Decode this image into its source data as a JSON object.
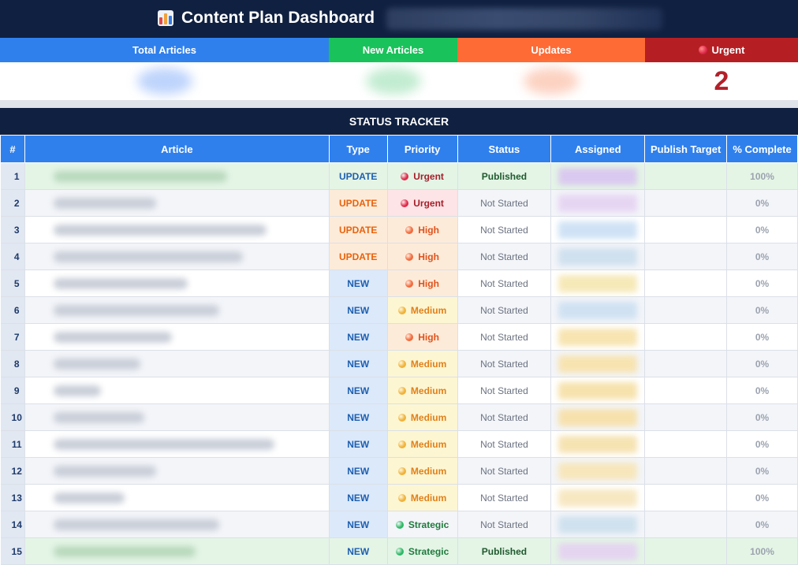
{
  "app": {
    "title": "Content Plan Dashboard",
    "icon": "bar-chart-icon"
  },
  "kpis": [
    {
      "label": "Total Articles",
      "color": "#2f80ed",
      "value": ""
    },
    {
      "label": "New Articles",
      "color": "#19c25a",
      "value": ""
    },
    {
      "label": "Updates",
      "color": "#ff6b35",
      "value": ""
    },
    {
      "label": "Urgent",
      "color": "#b51f24",
      "value": "2",
      "icon": "red-circle-icon"
    }
  ],
  "tracker": {
    "title": "STATUS TRACKER",
    "columns": [
      "#",
      "Article",
      "Type",
      "Priority",
      "Status",
      "Assigned",
      "Publish Target",
      "% Complete"
    ],
    "rows": [
      {
        "num": "1",
        "type": "UPDATE",
        "priority": "Urgent",
        "status": "Published",
        "complete": "100%"
      },
      {
        "num": "2",
        "type": "UPDATE",
        "priority": "Urgent",
        "status": "Not Started",
        "complete": "0%"
      },
      {
        "num": "3",
        "type": "UPDATE",
        "priority": "High",
        "status": "Not Started",
        "complete": "0%"
      },
      {
        "num": "4",
        "type": "UPDATE",
        "priority": "High",
        "status": "Not Started",
        "complete": "0%"
      },
      {
        "num": "5",
        "type": "NEW",
        "priority": "High",
        "status": "Not Started",
        "complete": "0%"
      },
      {
        "num": "6",
        "type": "NEW",
        "priority": "Medium",
        "status": "Not Started",
        "complete": "0%"
      },
      {
        "num": "7",
        "type": "NEW",
        "priority": "High",
        "status": "Not Started",
        "complete": "0%"
      },
      {
        "num": "8",
        "type": "NEW",
        "priority": "Medium",
        "status": "Not Started",
        "complete": "0%"
      },
      {
        "num": "9",
        "type": "NEW",
        "priority": "Medium",
        "status": "Not Started",
        "complete": "0%"
      },
      {
        "num": "10",
        "type": "NEW",
        "priority": "Medium",
        "status": "Not Started",
        "complete": "0%"
      },
      {
        "num": "11",
        "type": "NEW",
        "priority": "Medium",
        "status": "Not Started",
        "complete": "0%"
      },
      {
        "num": "12",
        "type": "NEW",
        "priority": "Medium",
        "status": "Not Started",
        "complete": "0%"
      },
      {
        "num": "13",
        "type": "NEW",
        "priority": "Medium",
        "status": "Not Started",
        "complete": "0%"
      },
      {
        "num": "14",
        "type": "NEW",
        "priority": "Strategic",
        "status": "Not Started",
        "complete": "0%"
      },
      {
        "num": "15",
        "type": "NEW",
        "priority": "Strategic",
        "status": "Published",
        "complete": "100%"
      }
    ]
  },
  "colors": {
    "navy": "#102040",
    "header_blue": "#2f80ed",
    "update_text": "#e8620c",
    "update_bg": "#fdebd9",
    "update_published_text": "#1e5fb0",
    "new_text": "#1e5fb0",
    "new_bg": "#dce9fa",
    "urgent_text": "#a51f2a",
    "urgent_bg": "#fde4e6",
    "urgent_dot": "#e0294a",
    "high_text": "#e0521c",
    "high_bg": "#fdebd9",
    "high_dot": "#f26a3c",
    "medium_text": "#e0801a",
    "medium_bg": "#fdf6d2",
    "medium_dot": "#f0b23a",
    "strategic_text": "#1f7a3c",
    "strategic_dot": "#2fb866",
    "published_row_bg": "#e4f5e6",
    "published_text": "#1f5a2e"
  }
}
